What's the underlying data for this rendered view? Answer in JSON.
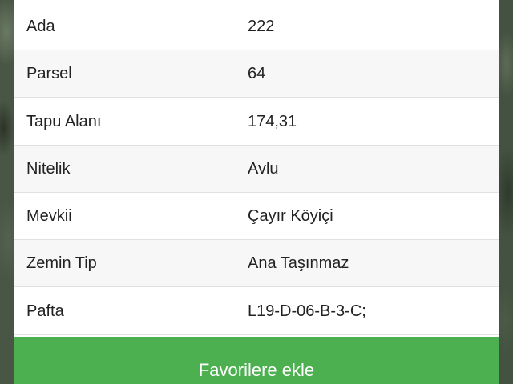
{
  "parcel_info": {
    "rows": [
      {
        "label": "Ada",
        "value": "222"
      },
      {
        "label": "Parsel",
        "value": "64"
      },
      {
        "label": "Tapu Alanı",
        "value": "174,31"
      },
      {
        "label": "Nitelik",
        "value": "Avlu"
      },
      {
        "label": "Mevkii",
        "value": "Çayır Köyiçi"
      },
      {
        "label": "Zemin Tip",
        "value": "Ana Taşınmaz"
      },
      {
        "label": "Pafta",
        "value": "L19-D-06-B-3-C;"
      }
    ]
  },
  "actions": {
    "favorite_label": "Favorilere ekle"
  },
  "colors": {
    "accent_green": "#4caf50",
    "row_alt_bg": "#f7f7f7",
    "divider": "#e1e1e1"
  }
}
